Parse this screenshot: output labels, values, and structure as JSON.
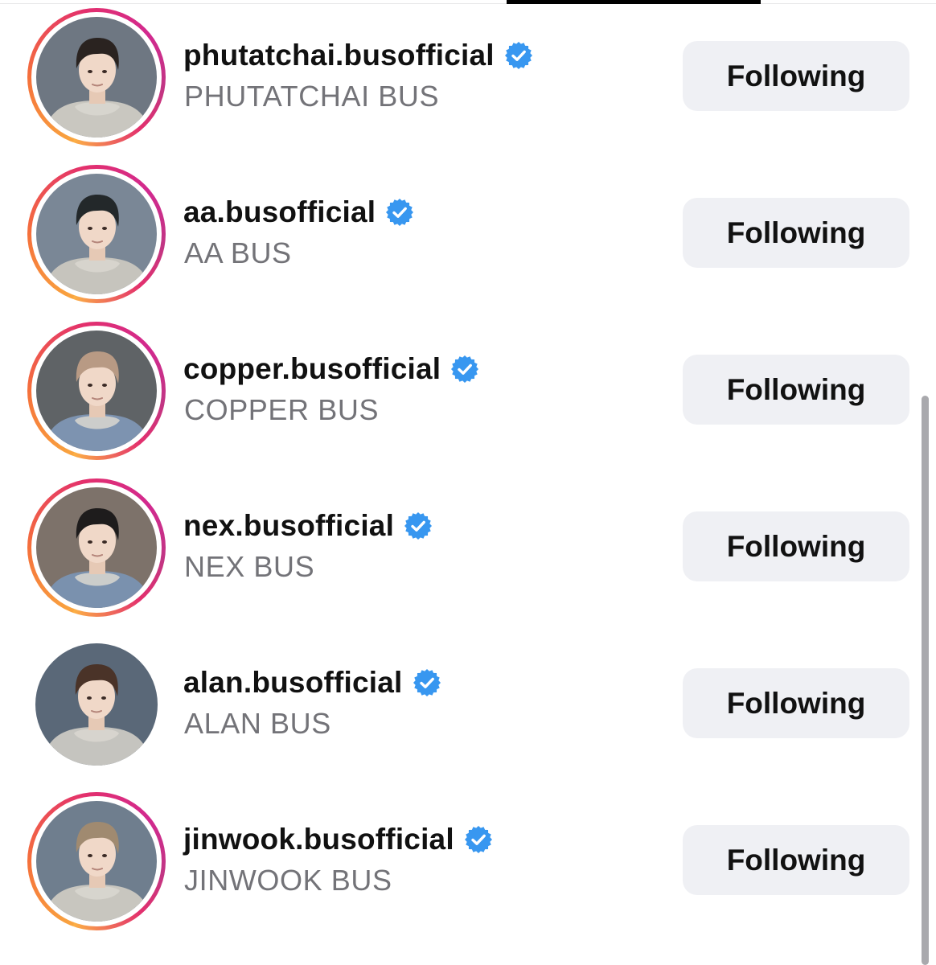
{
  "accounts": [
    {
      "username": "phutatchai.busofficial",
      "full_name": "PHUTATCHAI BUS",
      "button": "Following",
      "verified": true,
      "story_ring": true,
      "bg": "#6e7782",
      "hair": "#2a2320",
      "suit": "#c9c7c0"
    },
    {
      "username": "aa.busofficial",
      "full_name": "AA BUS",
      "button": "Following",
      "verified": true,
      "story_ring": true,
      "bg": "#7a8796",
      "hair": "#23282a",
      "suit": "#c6c4bd"
    },
    {
      "username": "copper.busofficial",
      "full_name": "COPPER BUS",
      "button": "Following",
      "verified": true,
      "story_ring": true,
      "bg": "#5f6366",
      "hair": "#b89a84",
      "suit": "#7d93b0"
    },
    {
      "username": "nex.busofficial",
      "full_name": "NEX BUS",
      "button": "Following",
      "verified": true,
      "story_ring": true,
      "bg": "#7d726a",
      "hair": "#1e1c1c",
      "suit": "#7a91ae"
    },
    {
      "username": "alan.busofficial",
      "full_name": "ALAN BUS",
      "button": "Following",
      "verified": true,
      "story_ring": false,
      "bg": "#5a6878",
      "hair": "#4a3328",
      "suit": "#c5c4bf"
    },
    {
      "username": "jinwook.busofficial",
      "full_name": "JINWOOK BUS",
      "button": "Following",
      "verified": true,
      "story_ring": true,
      "bg": "#6f7e8e",
      "hair": "#a08a70",
      "suit": "#c8c6bf"
    }
  ],
  "colors": {
    "verified_badge": "#3897f0",
    "button_bg": "#eff0f4",
    "secondary_text": "#737378"
  }
}
